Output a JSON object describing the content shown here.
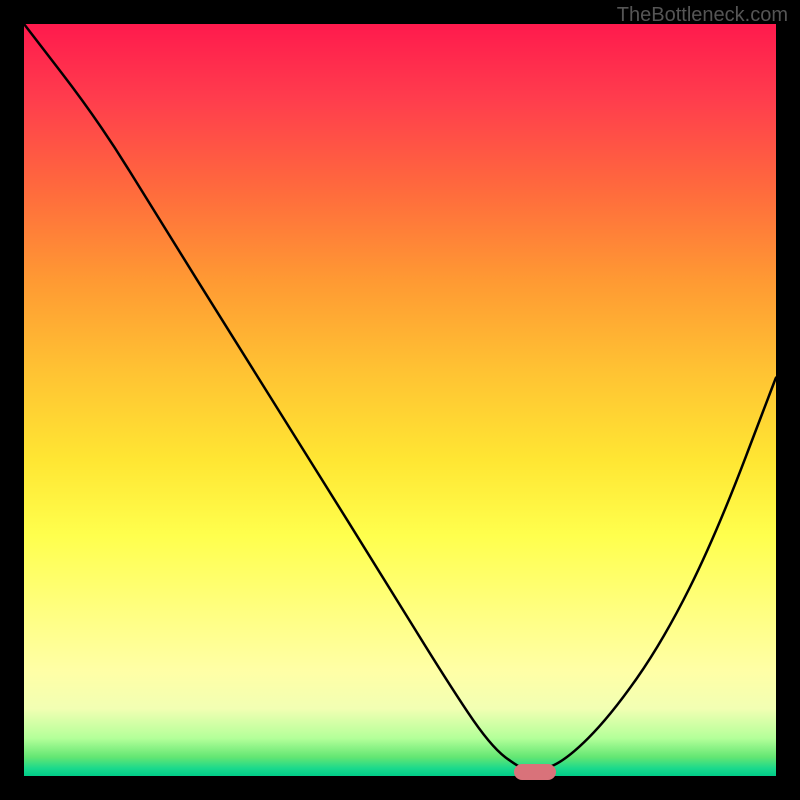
{
  "watermark": "TheBottleneck.com",
  "chart_data": {
    "type": "line",
    "title": "",
    "xlabel": "",
    "ylabel": "",
    "xlim": [
      0,
      100
    ],
    "ylim": [
      0,
      100
    ],
    "series": [
      {
        "name": "bottleneck-curve",
        "x": [
          0,
          10,
          18,
          28,
          38,
          48,
          56,
          62,
          66,
          68,
          72,
          78,
          85,
          92,
          100
        ],
        "values": [
          100,
          87,
          74,
          58,
          42,
          26,
          13,
          4,
          1,
          0.5,
          2,
          8,
          18,
          32,
          53
        ]
      }
    ],
    "optimal_marker": {
      "x": 68,
      "y": 0.5
    },
    "background_gradient": {
      "type": "heatmap_vertical",
      "top_color": "#ff1a4d",
      "mid_color": "#ffe633",
      "bottom_color": "#00cc88"
    }
  }
}
